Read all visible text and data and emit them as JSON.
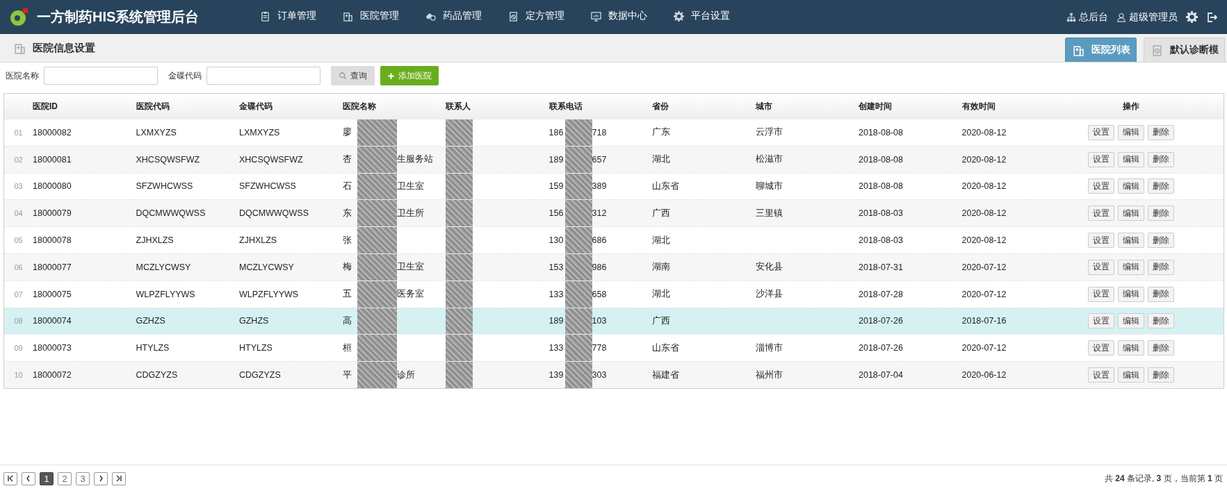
{
  "app": {
    "title": "一方制药HIS系统管理后台"
  },
  "nav": [
    {
      "label": "订单管理",
      "kind": "clipboard"
    },
    {
      "label": "医院管理",
      "kind": "hospital"
    },
    {
      "label": "药品管理",
      "kind": "pill"
    },
    {
      "label": "定方管理",
      "kind": "recipe"
    },
    {
      "label": "数据中心",
      "kind": "monitor"
    },
    {
      "label": "平台设置",
      "kind": "gear"
    }
  ],
  "user_menu": [
    {
      "label": "总后台",
      "kind": "sitemap"
    },
    {
      "label": "超级管理员",
      "kind": "user"
    }
  ],
  "page_title": "医院信息设置",
  "tabs": [
    {
      "label": "医院列表",
      "selected": true,
      "kind": "hospital"
    },
    {
      "label": "默认诊断模",
      "selected": false,
      "kind": "recipe"
    }
  ],
  "filters": [
    {
      "label": "医院名称"
    },
    {
      "label": "金碟代码"
    }
  ],
  "buttons": [
    {
      "label": "查询",
      "kind": "search"
    },
    {
      "label": "添加医院",
      "kind": "add"
    }
  ],
  "table": {
    "columns": [
      "医院ID",
      "医院代码",
      "金碟代码",
      "医院名称",
      "联系人",
      "联系电话",
      "省份",
      "城市",
      "创建时间",
      "有效时间",
      "操作"
    ],
    "rows": [
      {
        "index": "01",
        "id": "18000082",
        "hospital_code": "LXMXYZS",
        "kingdee_code": "LXMXYZS",
        "name_start": "廖",
        "phone_start": "186",
        "phone_end": "718",
        "province": "广东",
        "city": "云浮市",
        "created": "2018-08-08",
        "valid_until": "2020-08-12",
        "actions": [
          "设置",
          "编辑",
          "删除"
        ],
        "selected": false
      },
      {
        "index": "02",
        "id": "18000081",
        "hospital_code": "XHCSQWSFWZ",
        "kingdee_code": "XHCSQWSFWZ",
        "name_start": "杏",
        "name_end": "生服务站",
        "phone_start": "189",
        "phone_end": "657",
        "province": "湖北",
        "city": "松滋市",
        "created": "2018-08-08",
        "valid_until": "2020-08-12",
        "actions": [
          "设置",
          "编辑",
          "删除"
        ],
        "selected": false
      },
      {
        "index": "03",
        "id": "18000080",
        "hospital_code": "SFZWHCWSS",
        "kingdee_code": "SFZWHCWSS",
        "name_start": "石",
        "name_end": "卫生室",
        "phone_start": "159",
        "phone_end": "389",
        "province": "山东省",
        "city": "聊城市",
        "created": "2018-08-08",
        "valid_until": "2020-08-12",
        "actions": [
          "设置",
          "编辑",
          "删除"
        ],
        "selected": false
      },
      {
        "index": "04",
        "id": "18000079",
        "hospital_code": "DQCMWWQWSS",
        "kingdee_code": "DQCMWWQWSS",
        "name_start": "东",
        "name_end": "卫生所",
        "phone_start": "156",
        "phone_end": "312",
        "province": "广西",
        "city": "三里镇",
        "created": "2018-08-03",
        "valid_until": "2020-08-12",
        "actions": [
          "设置",
          "编辑",
          "删除"
        ],
        "selected": false
      },
      {
        "index": "05",
        "id": "18000078",
        "hospital_code": "ZJHXLZS",
        "kingdee_code": "ZJHXLZS",
        "name_start": "张",
        "phone_start": "130",
        "phone_end": "686",
        "province": "湖北",
        "created": "2018-08-03",
        "valid_until": "2020-08-12",
        "actions": [
          "设置",
          "编辑",
          "删除"
        ],
        "selected": false
      },
      {
        "index": "06",
        "id": "18000077",
        "hospital_code": "MCZLYCWSY",
        "kingdee_code": "MCZLYCWSY",
        "name_start": "梅",
        "name_end": "卫生室",
        "phone_start": "153",
        "phone_end": "986",
        "province": "湖南",
        "city": "安化县",
        "created": "2018-07-31",
        "valid_until": "2020-07-12",
        "actions": [
          "设置",
          "编辑",
          "删除"
        ],
        "selected": false
      },
      {
        "index": "07",
        "id": "18000075",
        "hospital_code": "WLPZFLYYWS",
        "kingdee_code": "WLPZFLYYWS",
        "name_start": "五",
        "name_end": "医务室",
        "phone_start": "133",
        "phone_end": "658",
        "province": "湖北",
        "city": "沙洋县",
        "created": "2018-07-28",
        "valid_until": "2020-07-12",
        "actions": [
          "设置",
          "编辑",
          "删除"
        ],
        "selected": false
      },
      {
        "index": "08",
        "id": "18000074",
        "hospital_code": "GZHZS",
        "kingdee_code": "GZHZS",
        "name_start": "高",
        "phone_start": "189",
        "phone_end": "103",
        "province": "广西",
        "created": "2018-07-26",
        "valid_until": "2018-07-16",
        "actions": [
          "设置",
          "编辑",
          "删除"
        ],
        "selected": true
      },
      {
        "index": "09",
        "id": "18000073",
        "hospital_code": "HTYLZS",
        "kingdee_code": "HTYLZS",
        "name_start": "桓",
        "phone_start": "133",
        "phone_end": "778",
        "province": "山东省",
        "city": "淄博市",
        "created": "2018-07-26",
        "valid_until": "2020-07-12",
        "actions": [
          "设置",
          "编辑",
          "删除"
        ],
        "selected": false
      },
      {
        "index": "10",
        "id": "18000072",
        "hospital_code": "CDGZYZS",
        "kingdee_code": "CDGZYZS",
        "name_start": "平",
        "name_end": "诊所",
        "phone_start": "139",
        "phone_end": "303",
        "province": "福建省",
        "city": "福州市",
        "created": "2018-07-04",
        "valid_until": "2020-06-12",
        "actions": [
          "设置",
          "编辑",
          "删除"
        ],
        "selected": false
      }
    ]
  },
  "pagination": {
    "pages": [
      {
        "label": "1",
        "selected": true
      },
      {
        "label": "2",
        "selected": false
      },
      {
        "label": "3",
        "selected": false
      }
    ],
    "summary": "共 **24** 条记录, **3** 页，当前第 **1** 页"
  }
}
